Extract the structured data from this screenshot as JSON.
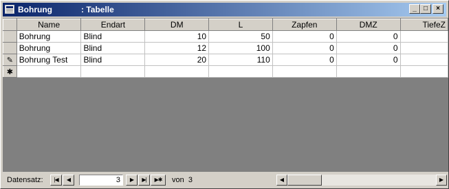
{
  "window": {
    "table_name": "Bohrung",
    "object_type": ": Tabelle",
    "controls": {
      "minimize": "_",
      "maximize": "□",
      "close": "×"
    }
  },
  "grid": {
    "columns": [
      "Name",
      "Endart",
      "DM",
      "L",
      "Zapfen",
      "DMZ",
      "TiefeZ"
    ],
    "rows": [
      {
        "selector": "",
        "cells": [
          "Bohrung",
          "Blind",
          "10",
          "50",
          "0",
          "0",
          ""
        ]
      },
      {
        "selector": "",
        "cells": [
          "Bohrung",
          "Blind",
          "12",
          "100",
          "0",
          "0",
          ""
        ]
      },
      {
        "selector": "✎",
        "cells": [
          "Bohrung Test",
          "Blind",
          "20",
          "110",
          "0",
          "0",
          ""
        ]
      },
      {
        "selector": "✱",
        "cells": [
          "",
          "",
          "",
          "",
          "",
          "",
          ""
        ]
      }
    ]
  },
  "navigation": {
    "label": "Datensatz:",
    "current": "3",
    "of_label": "von",
    "total": "3",
    "buttons": {
      "first": "|◀",
      "prev": "◀",
      "next": "▶",
      "last": "▶|",
      "new": "▶✱"
    }
  },
  "scrollbar": {
    "left": "◀",
    "right": "▶"
  },
  "colors": {
    "title_start": "#0a246a",
    "title_end": "#a6caf0",
    "empty_area": "#808080",
    "face": "#d4d0c8"
  }
}
